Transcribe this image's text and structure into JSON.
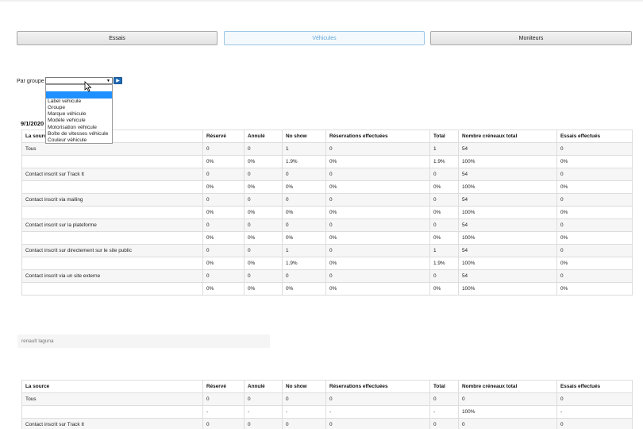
{
  "tabs": [
    "Essais",
    "Véhicules",
    "Moniteurs"
  ],
  "active_tab": 1,
  "group_filter": {
    "label": "Par groupe :",
    "selected": "",
    "options": [
      "",
      "",
      "Label vehicule",
      "Groupe",
      "Marque véhicule",
      "Modèle vehicule",
      "Motorisation véhicule",
      "Boîte de vitesses véhicule",
      "Couleur véhicule"
    ]
  },
  "section1": {
    "date": "9/1/2020",
    "headers": [
      "La source",
      "Réservé",
      "Annulé",
      "No show",
      "Réservations effectuées",
      "Total",
      "Nombre créneaux total",
      "Essais effectués"
    ],
    "rows": [
      [
        "Tous",
        "0",
        "0",
        "1",
        "0",
        "1",
        "54",
        "0"
      ],
      [
        "",
        "0%",
        "0%",
        "1.9%",
        "0%",
        "1.9%",
        "100%",
        "0%"
      ],
      [
        "Contact inscrit sur Track It",
        "0",
        "0",
        "0",
        "0",
        "0",
        "54",
        "0"
      ],
      [
        "",
        "0%",
        "0%",
        "0%",
        "0%",
        "0%",
        "100%",
        "0%"
      ],
      [
        "Contact inscrit via mailing",
        "0",
        "0",
        "0",
        "0",
        "0",
        "54",
        "0"
      ],
      [
        "",
        "0%",
        "0%",
        "0%",
        "0%",
        "0%",
        "100%",
        "0%"
      ],
      [
        "Contact inscrit sur la plateforme",
        "0",
        "0",
        "0",
        "0",
        "0",
        "54",
        "0"
      ],
      [
        "",
        "0%",
        "0%",
        "0%",
        "0%",
        "0%",
        "100%",
        "0%"
      ],
      [
        "Contact inscrit sur directement sur le site public",
        "0",
        "0",
        "1",
        "0",
        "1",
        "54",
        "0"
      ],
      [
        "",
        "0%",
        "0%",
        "1.9%",
        "0%",
        "1.9%",
        "100%",
        "0%"
      ],
      [
        "Contact inscrit via un site externe",
        "0",
        "0",
        "0",
        "0",
        "0",
        "54",
        "0"
      ],
      [
        "",
        "0%",
        "0%",
        "0%",
        "0%",
        "0%",
        "100%",
        "0%"
      ]
    ]
  },
  "section2": {
    "title": "renault laguna",
    "headers": [
      "La source",
      "Réservé",
      "Annulé",
      "No show",
      "Réservations effectuées",
      "Total",
      "Nombre créneaux total",
      "Essais effectués"
    ],
    "rows": [
      [
        "Tous",
        "0",
        "0",
        "0",
        "0",
        "0",
        "0",
        "0"
      ],
      [
        "",
        "-",
        "-",
        "-",
        "-",
        "-",
        "100%",
        "-"
      ],
      [
        "Contact inscrit sur Track It",
        "0",
        "0",
        "0",
        "0",
        "0",
        "0",
        "0"
      ]
    ]
  }
}
